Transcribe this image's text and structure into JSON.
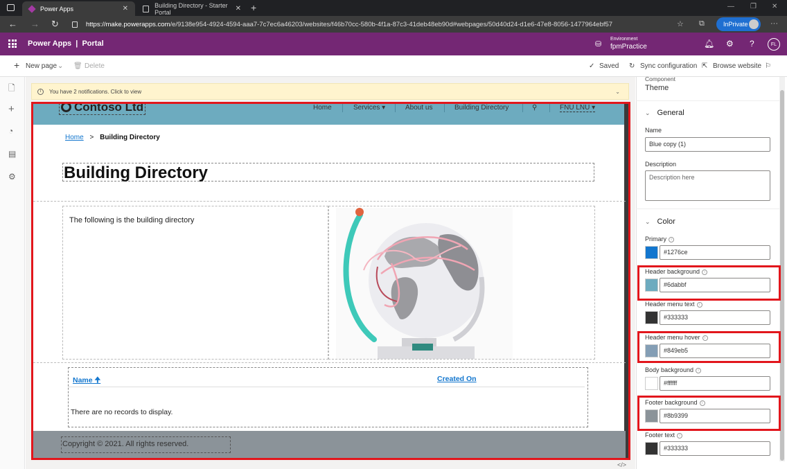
{
  "browser": {
    "tabs": [
      {
        "label": "Power Apps",
        "active": true
      },
      {
        "label": "Building Directory - Starter Portal",
        "active": false
      }
    ],
    "url_host": "https://make.powerapps.com",
    "url_path": "/e/9138e954-4924-4594-aaa7-7c7ec6a46203/websites/f46b70cc-580b-4f1a-87c3-41deb48eb90d#webpages/50d40d24-d1e6-47e8-8056-1477964ebf57",
    "inprivate_label": "InPrivate"
  },
  "appbar": {
    "title": "Power Apps  |  Portal",
    "env_label": "Environment",
    "env_name": "fpmPractice",
    "user_initials": "FL"
  },
  "cmdbar": {
    "new_page": "New page",
    "delete": "Delete",
    "saved": "Saved",
    "sync": "Sync configuration",
    "browse": "Browse website"
  },
  "notification": {
    "text": "You have 2 notifications. Click to view"
  },
  "site": {
    "logo": "Contoso Ltd",
    "menu": [
      "Home",
      "Services ▾",
      "About us",
      "Building Directory",
      "FNU LNU ▾"
    ],
    "breadcrumb_home": "Home",
    "breadcrumb_sep": ">",
    "breadcrumb_current": "Building Directory",
    "page_title": "Building Directory",
    "intro_text": "The following is the building directory",
    "list_col_name": "Name",
    "list_col_created": "Created On",
    "empty_text": "There are no records to display.",
    "copyright": "Copyright © 2021. All rights reserved."
  },
  "panel": {
    "component_label": "Component",
    "component_value": "Theme",
    "general_section": "General",
    "name_label": "Name",
    "name_value": "Blue copy (1)",
    "description_label": "Description",
    "description_placeholder": "Description here",
    "color_section": "Color",
    "colors": [
      {
        "label": "Primary",
        "value": "#1276ce",
        "swatch": "#1276ce",
        "highlighted": false
      },
      {
        "label": "Header background",
        "value": "#6dabbf",
        "swatch": "#6dabbf",
        "highlighted": true
      },
      {
        "label": "Header menu text",
        "value": "#333333",
        "swatch": "#333333",
        "highlighted": false
      },
      {
        "label": "Header menu hover",
        "value": "#849eb5",
        "swatch": "#849eb5",
        "highlighted": true
      },
      {
        "label": "Body background",
        "value": "#ffffff",
        "swatch": "#ffffff",
        "highlighted": false
      },
      {
        "label": "Footer background",
        "value": "#8b9399",
        "swatch": "#8b9399",
        "highlighted": true
      },
      {
        "label": "Footer text",
        "value": "#333333",
        "swatch": "#333333",
        "highlighted": false
      }
    ]
  },
  "accent": {
    "app_purple": "#742774",
    "highlight_red": "#e2161c"
  }
}
